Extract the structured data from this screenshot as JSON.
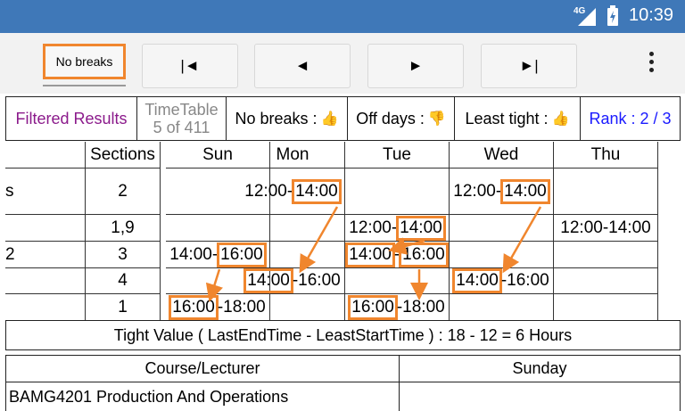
{
  "status_bar": {
    "network": "4G",
    "time": "10:39"
  },
  "toolbar": {
    "no_breaks_label": "No breaks",
    "first_label": "|◄",
    "prev_label": "◄",
    "next_label": "►",
    "last_label": "►|"
  },
  "info": {
    "filtered_results": "Filtered Results",
    "timetable_title": "TimeTable",
    "timetable_count": "5 of 411",
    "no_breaks": "No breaks :",
    "off_days": "Off days :",
    "least_tight": "Least tight :",
    "rank": "Rank : 2 / 3"
  },
  "colors": {
    "accent": "#f0862e",
    "status_bar": "#3f78b8",
    "purple": "#8b1a8b",
    "rank_blue": "#1a1aff"
  },
  "grid": {
    "headers": [
      "Sections",
      "Sun",
      "Mon",
      "Tue",
      "Wed",
      "Thu"
    ],
    "rows": [
      {
        "left": "s",
        "section": "2",
        "sun": "",
        "mon": [
          "12:00-",
          "14:00",
          ""
        ],
        "tue": "",
        "wed": [
          "12:00-",
          "14:00",
          ""
        ],
        "thu": ""
      },
      {
        "left": "",
        "section": "1,9",
        "sun": "",
        "mon": "",
        "tue": [
          "12:00-",
          "14:00",
          ""
        ],
        "wed": "",
        "thu": "12:00-14:00"
      },
      {
        "left": "2",
        "section": "3",
        "sun": [
          "14:00-",
          "16:00",
          ""
        ],
        "mon": "",
        "tue": [
          "",
          "14:00",
          "-",
          "16:00"
        ],
        "wed": "",
        "thu": ""
      },
      {
        "left": "",
        "section": "4",
        "sun": "",
        "mon": [
          "",
          "14:00",
          "-16:00"
        ],
        "tue": "",
        "wed": [
          "",
          "14:00",
          "-16:00"
        ],
        "thu": ""
      },
      {
        "left": "",
        "section": "1",
        "sun": [
          "",
          "16:00",
          "-18:00"
        ],
        "mon": "",
        "tue": [
          "",
          "16:00",
          "-18:00"
        ],
        "wed": "",
        "thu": ""
      }
    ]
  },
  "tight_value": "Tight Value ( LastEndTime - LeastStartTime ) : 18 - 12 = 6 Hours",
  "course_table": {
    "headers": [
      "Course/Lecturer",
      "Sunday"
    ],
    "first_row": "BAMG4201 Production And Operations"
  }
}
